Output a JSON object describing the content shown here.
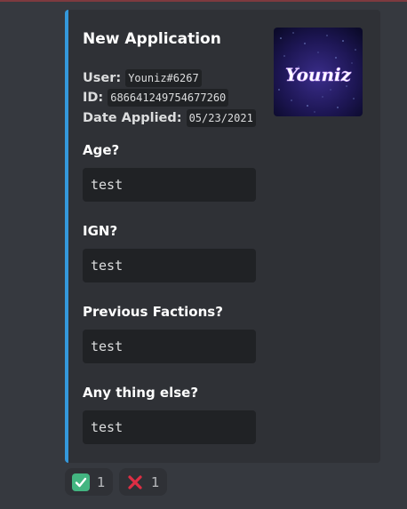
{
  "embed": {
    "accent_color": "#3498db",
    "title": "New Application",
    "meta": [
      {
        "label": "User:",
        "value": "Youniz#6267"
      },
      {
        "label": "ID:",
        "value": "686641249754677260"
      },
      {
        "label": "Date Applied:",
        "value": "05/23/2021"
      }
    ],
    "thumbnail": {
      "text": "Youniz"
    },
    "fields": [
      {
        "name": "Age?",
        "value": "test"
      },
      {
        "name": "IGN?",
        "value": "test"
      },
      {
        "name": "Previous Factions?",
        "value": "test"
      },
      {
        "name": "Any thing else?",
        "value": "test"
      }
    ]
  },
  "reactions": [
    {
      "icon": "check-mark-icon",
      "color": "#43b581",
      "count": "1"
    },
    {
      "icon": "cross-mark-icon",
      "color": "#dd2e44",
      "count": "1"
    }
  ]
}
